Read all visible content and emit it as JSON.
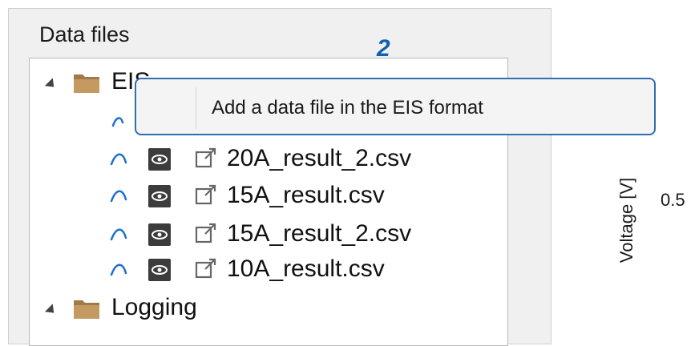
{
  "panel": {
    "title": "Data files"
  },
  "tree": {
    "folders": [
      {
        "label": "EIS"
      },
      {
        "label": "Logging"
      }
    ],
    "files": [
      {
        "name": "20A_result_2.csv"
      },
      {
        "name": "15A_result.csv"
      },
      {
        "name": "15A_result_2.csv"
      },
      {
        "name": "10A_result.csv"
      }
    ]
  },
  "context_menu": {
    "item": "Add a data file in the EIS format"
  },
  "callout": {
    "number": "2"
  },
  "chart_axis": {
    "ylabel": "Voltage [V]",
    "tick": "0.5"
  },
  "colors": {
    "accent": "#2f6fae",
    "wave": "#1f6fd1",
    "folder": "#a07a4a"
  },
  "icons": [
    "expand-arrow-icon",
    "folder-icon",
    "waveform-icon",
    "eye-icon",
    "external-link-icon"
  ]
}
